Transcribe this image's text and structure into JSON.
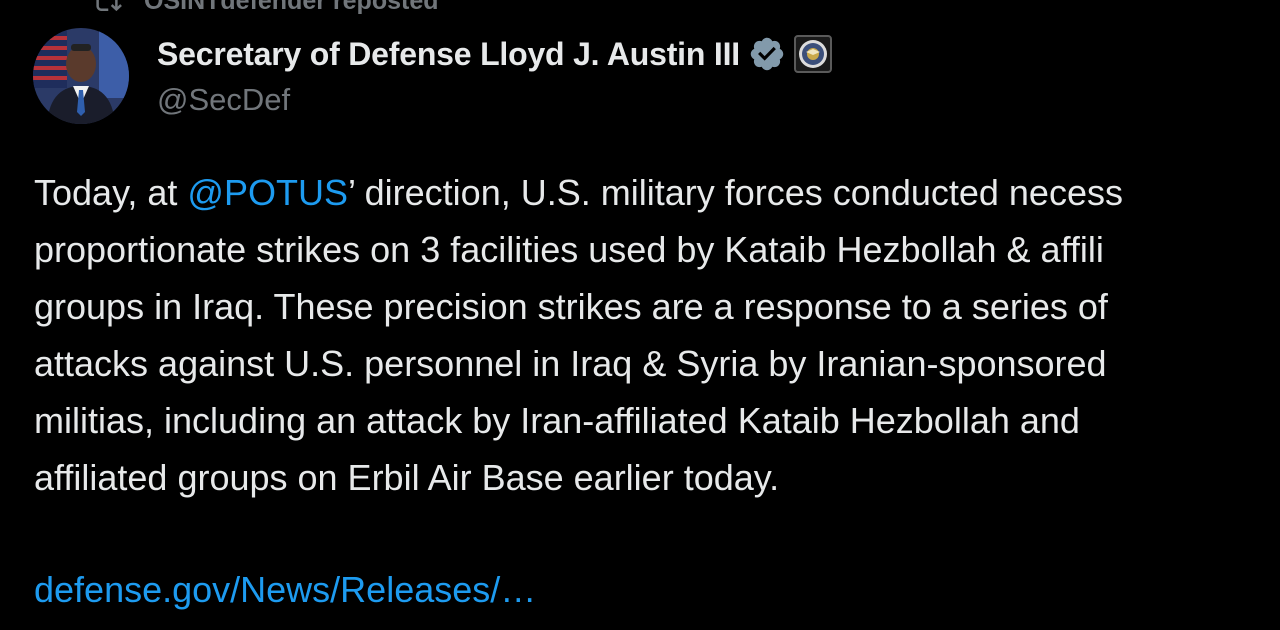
{
  "repost": {
    "text": "OSINTdefender reposted",
    "icon": "repost-icon"
  },
  "author": {
    "display_name": "Secretary of Defense Lloyd J. Austin III",
    "handle": "@SecDef",
    "verified_icon": "verified-badge-icon",
    "affiliation_icon": "department-of-defense-seal-icon",
    "badge_color": "#829aab"
  },
  "tweet": {
    "line1_pre": "Today, at ",
    "line1_mention": "@POTUS",
    "line1_post": "’ direction, U.S. military forces conducted necess",
    "line2": "proportionate strikes on 3 facilities used by Kataib Hezbollah & affili",
    "line3": "groups in Iraq. These precision strikes are a response to a series of",
    "line4": "attacks against U.S. personnel in Iraq & Syria by Iranian-sponsored",
    "line5": "militias, including an attack by Iran-affiliated Kataib Hezbollah and",
    "line6": "affiliated groups on Erbil Air Base earlier today.",
    "link": "defense.gov/News/Releases/…"
  },
  "colors": {
    "background": "#000000",
    "text": "#e7e9ea",
    "secondary": "#71767b",
    "link": "#1d9bf0"
  }
}
